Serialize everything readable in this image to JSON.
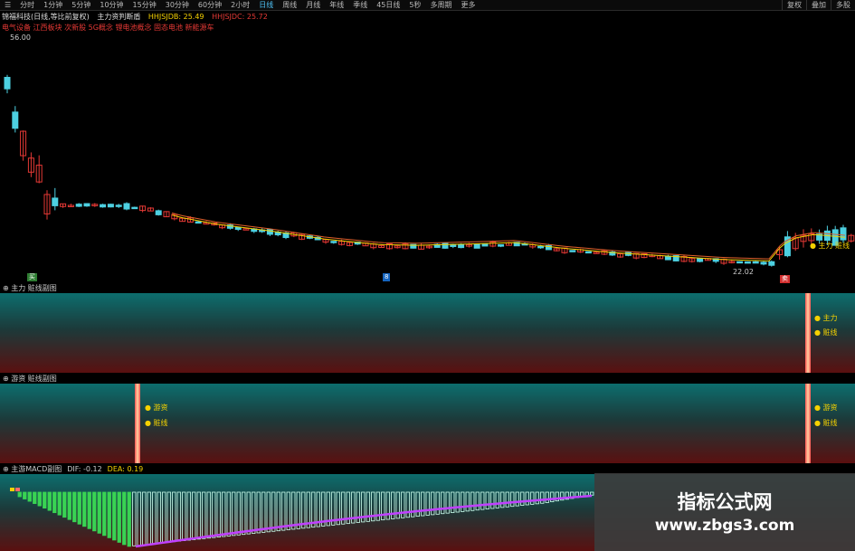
{
  "toolbar": {
    "tabs": [
      "分时",
      "1分钟",
      "5分钟",
      "10分钟",
      "15分钟",
      "30分钟",
      "60分钟",
      "2小时",
      "日线",
      "周线",
      "月线",
      "年线",
      "季线",
      "45日线",
      "5秒",
      "多周期",
      "更多"
    ],
    "active_tab": "日线",
    "right_tabs": [
      "复权",
      "叠加",
      "多股"
    ]
  },
  "header": {
    "stock": "锦福科技(日线,等比前复权)",
    "indicator": "主力资判断盾",
    "hh_line": "HHJSJDB: 25.49",
    "hh_line2": "HHJSJDC: 25.72",
    "sectors": "电气设备 江西板块 次新股 5G概念 锂电池概念 固态电池 新能源车"
  },
  "chart": {
    "max_label": "56.00",
    "min_label": "22.02",
    "tag_left": "买",
    "tag_mid": "8",
    "tag_right": "卖",
    "signal_label": "主力 赃线",
    "colors": {
      "up": "#e53935",
      "down": "#4dd0e1",
      "ma1": "#f5d100",
      "ma2": "#e0602a"
    }
  },
  "panel1": {
    "title": "主力 赃线副图",
    "labels": [
      "主力",
      "赃线"
    ]
  },
  "panel2": {
    "title": "游资 赃线副图",
    "labels_left": [
      "游资",
      "赃线"
    ],
    "labels_right": [
      "游资",
      "赃线"
    ]
  },
  "panel3": {
    "title": "主游MACD副图",
    "dif": "DIF: -0.12",
    "dea": "DEA: 0.19"
  },
  "watermark": {
    "line1": "指标公式网",
    "line2": "www.zbgs3.com"
  }
}
